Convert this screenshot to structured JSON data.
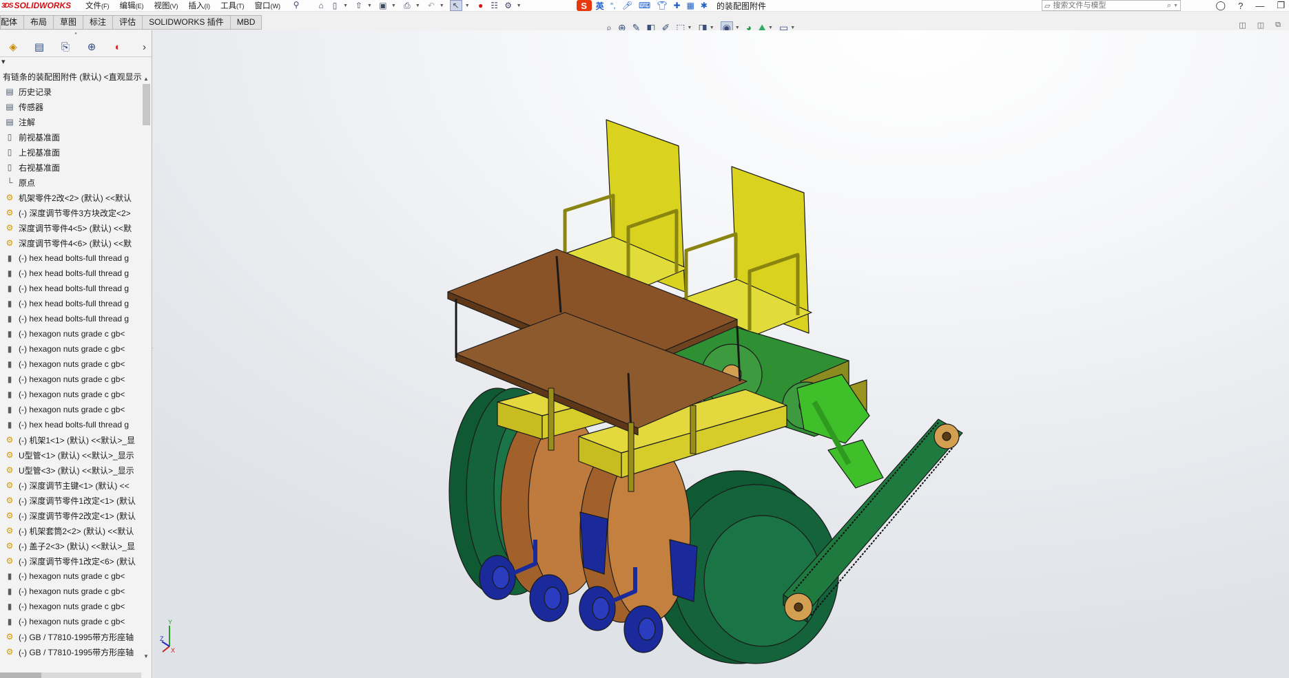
{
  "app": {
    "logo": "SOLIDWORKS",
    "logo_prefix": "3DS",
    "doc_title": "的装配图附件"
  },
  "menu": [
    {
      "label": "文件",
      "key": "(F)"
    },
    {
      "label": "编辑",
      "key": "(E)"
    },
    {
      "label": "视图",
      "key": "(V)"
    },
    {
      "label": "插入",
      "key": "(I)"
    },
    {
      "label": "工具",
      "key": "(T)"
    },
    {
      "label": "窗口",
      "key": "(W)"
    }
  ],
  "ime": {
    "logo": "S",
    "lang": "英"
  },
  "search": {
    "placeholder": "搜索文件与模型"
  },
  "cmd_tabs": [
    "配体",
    "布局",
    "草图",
    "标注",
    "评估",
    "SOLIDWORKS 插件",
    "MBD"
  ],
  "tree": {
    "root": "有链条的装配图附件 (默认) <直观显示",
    "items": [
      {
        "icon": "history-icon",
        "label": "历史记录",
        "type": "folder"
      },
      {
        "icon": "sensor-icon",
        "label": "传感器",
        "type": "folder"
      },
      {
        "icon": "annotation-icon",
        "label": "注解",
        "type": "folder"
      },
      {
        "icon": "plane-icon",
        "label": "前视基准面",
        "type": "plane"
      },
      {
        "icon": "plane-icon",
        "label": "上视基准面",
        "type": "plane"
      },
      {
        "icon": "plane-icon",
        "label": "右视基准面",
        "type": "plane"
      },
      {
        "icon": "origin-icon",
        "label": "原点",
        "type": "origin"
      },
      {
        "icon": "part-icon",
        "label": "机架零件2改<2> (默认) <<默认",
        "type": "part"
      },
      {
        "icon": "part-icon",
        "label": "(-) 深度调节零件3方块改定<2>",
        "type": "part"
      },
      {
        "icon": "part-icon",
        "label": "深度调节零件4<5> (默认) <<默",
        "type": "part"
      },
      {
        "icon": "part-icon",
        "label": "深度调节零件4<6> (默认) <<默",
        "type": "part"
      },
      {
        "icon": "bolt-icon",
        "label": "(-) hex head bolts-full thread g",
        "type": "bolt"
      },
      {
        "icon": "bolt-icon",
        "label": "(-) hex head bolts-full thread g",
        "type": "bolt"
      },
      {
        "icon": "bolt-icon",
        "label": "(-) hex head bolts-full thread g",
        "type": "bolt"
      },
      {
        "icon": "bolt-icon",
        "label": "(-) hex head bolts-full thread g",
        "type": "bolt"
      },
      {
        "icon": "bolt-icon",
        "label": "(-) hex head bolts-full thread g",
        "type": "bolt"
      },
      {
        "icon": "bolt-icon",
        "label": "(-) hexagon nuts grade c gb<",
        "type": "bolt"
      },
      {
        "icon": "bolt-icon",
        "label": "(-) hexagon nuts grade c gb<",
        "type": "bolt"
      },
      {
        "icon": "bolt-icon",
        "label": "(-) hexagon nuts grade c gb<",
        "type": "bolt"
      },
      {
        "icon": "bolt-icon",
        "label": "(-) hexagon nuts grade c gb<",
        "type": "bolt"
      },
      {
        "icon": "bolt-icon",
        "label": "(-) hexagon nuts grade c gb<",
        "type": "bolt"
      },
      {
        "icon": "bolt-icon",
        "label": "(-) hexagon nuts grade c gb<",
        "type": "bolt"
      },
      {
        "icon": "bolt-icon",
        "label": "(-) hex head bolts-full thread g",
        "type": "bolt"
      },
      {
        "icon": "part-icon",
        "label": "(-) 机架1<1> (默认) <<默认>_显",
        "type": "part"
      },
      {
        "icon": "part-icon",
        "label": "U型管<1> (默认) <<默认>_显示",
        "type": "part"
      },
      {
        "icon": "part-icon",
        "label": "U型管<3> (默认) <<默认>_显示",
        "type": "part"
      },
      {
        "icon": "part-icon",
        "label": "(-) 深度调节主键<1> (默认) <<",
        "type": "part"
      },
      {
        "icon": "part-icon",
        "label": "(-) 深度调节零件1改定<1> (默认",
        "type": "part"
      },
      {
        "icon": "part-icon",
        "label": "(-) 深度调节零件2改定<1> (默认",
        "type": "part"
      },
      {
        "icon": "part-icon",
        "label": "(-) 机架套筒2<2> (默认) <<默认",
        "type": "part"
      },
      {
        "icon": "part-icon",
        "label": "(-) 盖子2<3> (默认) <<默认>_显",
        "type": "part"
      },
      {
        "icon": "part-icon",
        "label": "(-) 深度调节零件1改定<6> (默认",
        "type": "part"
      },
      {
        "icon": "bolt-icon",
        "label": "(-) hexagon nuts grade c gb<",
        "type": "bolt"
      },
      {
        "icon": "bolt-icon",
        "label": "(-) hexagon nuts grade c gb<",
        "type": "bolt"
      },
      {
        "icon": "bolt-icon",
        "label": "(-) hexagon nuts grade c gb<",
        "type": "bolt"
      },
      {
        "icon": "bolt-icon",
        "label": "(-) hexagon nuts grade c gb<",
        "type": "bolt"
      },
      {
        "icon": "asm-icon",
        "label": "(-) GB / T7810-1995带方形座轴",
        "type": "asm"
      },
      {
        "icon": "asm-icon",
        "label": "(-) GB / T7810-1995带方形座轴",
        "type": "asm"
      }
    ]
  },
  "triad": {
    "x": "X",
    "y": "Y",
    "z": "Z"
  },
  "colors": {
    "frame_yellow": "#d9d21f",
    "top_board": "#8a5327",
    "drum": "#bf7a3d",
    "wheel": "#14633a",
    "chain_arm": "#1f7a40",
    "gauge_wheel": "#1a2a9a",
    "link_green": "#3fbf2a"
  }
}
